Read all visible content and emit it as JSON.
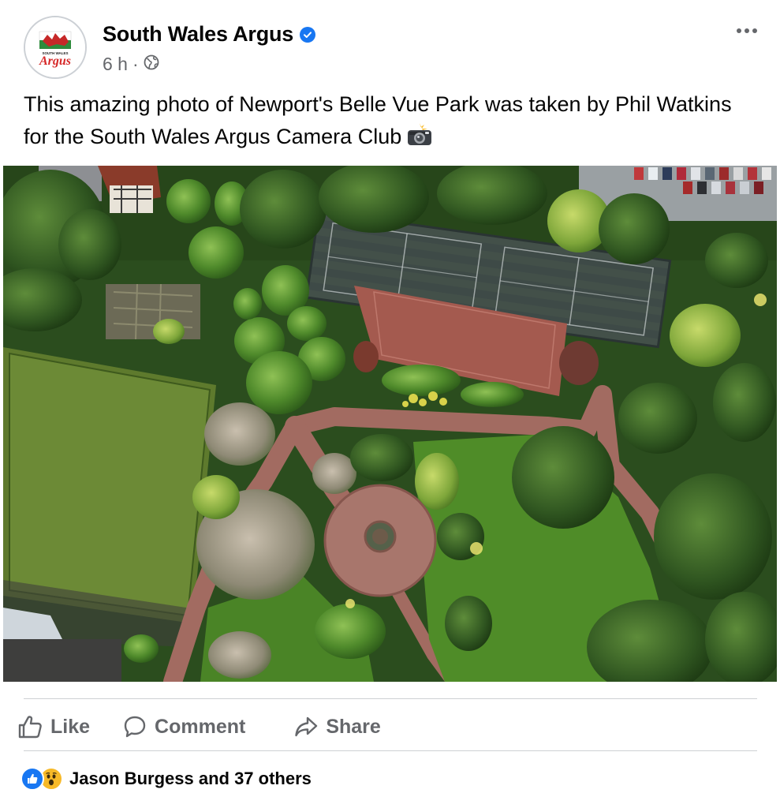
{
  "post": {
    "page_name": "South Wales Argus",
    "time": "6 h",
    "separator": "·",
    "audience_icon": "globe-icon",
    "caption": "This amazing photo of Newport's Belle Vue Park was taken by Phil Watkins for the South Wales Argus Camera Club",
    "caption_emoji": "camera-flash-icon",
    "logo_text_top": "SOUTH WALES",
    "logo_text_main": "Argus"
  },
  "actions": {
    "like_label": "Like",
    "comment_label": "Comment",
    "share_label": "Share"
  },
  "reactions": {
    "summary": "Jason Burgess and 37 others",
    "icons": [
      "like-reaction-icon",
      "wow-reaction-icon"
    ]
  },
  "colors": {
    "accent": "#1877f2",
    "secondary_text": "#65676b",
    "logo_red": "#d62828",
    "wow_yellow": "#f7b928"
  }
}
